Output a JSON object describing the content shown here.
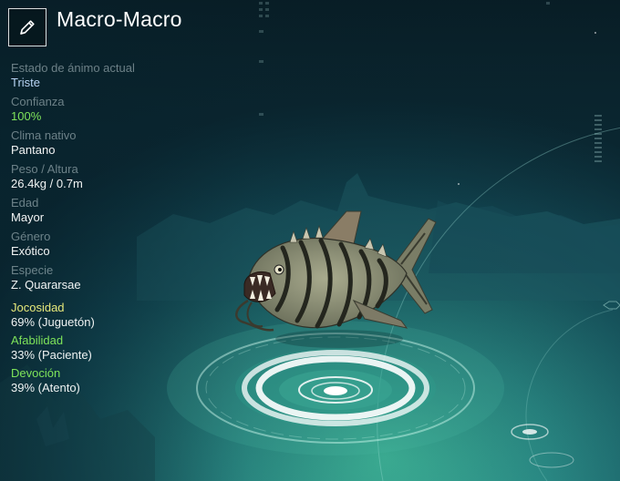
{
  "creature": {
    "name": "Macro-Macro"
  },
  "stats": [
    {
      "label": "Estado de ánimo actual",
      "value": "Triste",
      "value_color": "#b8d4f4"
    },
    {
      "label": "Confianza",
      "value": "100%",
      "value_color": "#7ee35a"
    },
    {
      "label": "Clima nativo",
      "value": "Pantano",
      "value_color": "#f2f4f4"
    },
    {
      "label": "Peso / Altura",
      "value": "26.4kg / 0.7m",
      "value_color": "#f2f4f4"
    },
    {
      "label": "Edad",
      "value": "Mayor",
      "value_color": "#f2f4f4"
    },
    {
      "label": "Género",
      "value": "Exótico",
      "value_color": "#f2f4f4"
    },
    {
      "label": "Especie",
      "value": "Z. Quararsae",
      "value_color": "#f2f4f4"
    }
  ],
  "traits": [
    {
      "label": "Jocosidad",
      "value": "69% (Juguetón)",
      "label_color": "#e6e87a"
    },
    {
      "label": "Afabilidad",
      "value": "33% (Paciente)",
      "label_color": "#7ee35a"
    },
    {
      "label": "Devoción",
      "value": "39% (Atento)",
      "label_color": "#7ee35a"
    }
  ],
  "icons": {
    "edit": "pencil-icon"
  }
}
